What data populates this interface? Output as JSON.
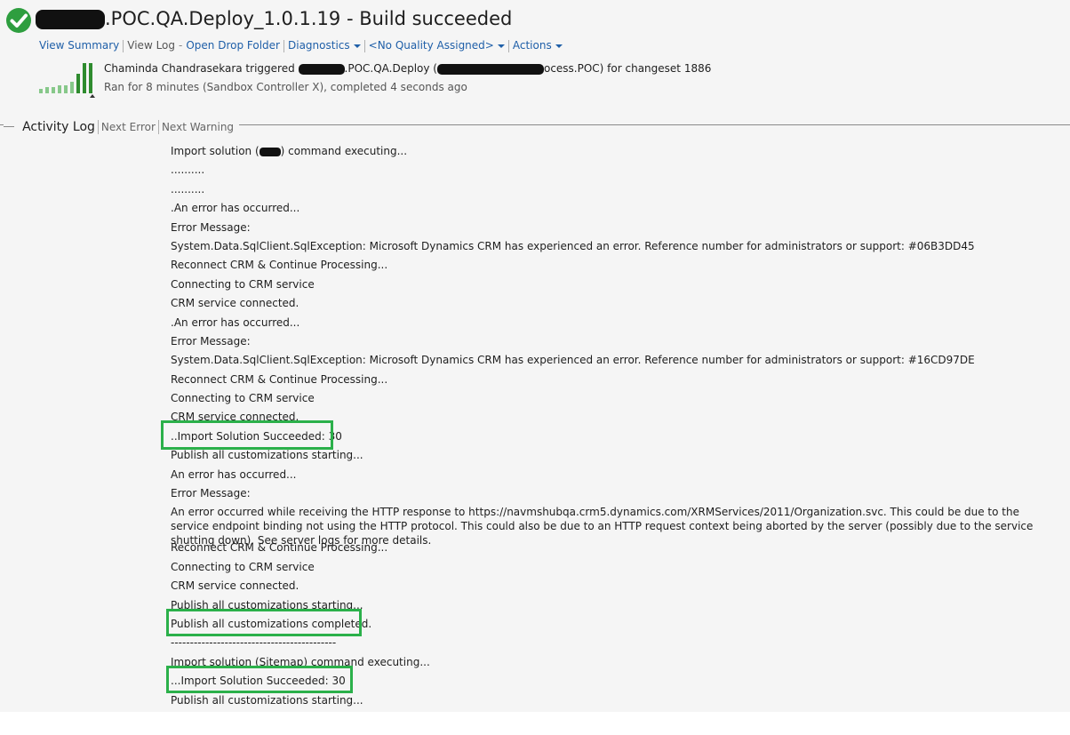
{
  "header": {
    "title": ".POC.QA.Deploy_1.0.1.19 - Build succeeded",
    "status_color": "#2e9e3f"
  },
  "nav": {
    "view_summary": "View Summary",
    "view_log": "View Log",
    "dash": "-",
    "open_drop_folder": "Open Drop Folder",
    "diagnostics": "Diagnostics",
    "quality": "<No Quality Assigned>",
    "actions": "Actions"
  },
  "build_info": {
    "trigger_user": "Chaminda Chandrasekara triggered",
    "trigger_def": ".POC.QA.Deploy (",
    "trigger_def_end": "ocess.POC) for changeset 1886",
    "ran_for": "Ran for 8 minutes (Sandbox Controller X), completed 4 seconds ago",
    "history_bar_levels": [
      0.15,
      0.2,
      0.2,
      0.25,
      0.25,
      0.35,
      0.6,
      0.95,
      0.95
    ],
    "accent_color": "#2e8b2e"
  },
  "tabs": {
    "activity_log": "Activity Log",
    "next_error": "Next Error",
    "next_warning": "Next Warning"
  },
  "log": {
    "import_start_a": "Import solution (",
    "import_start_b": ") command executing...",
    "lines_1": [
      "..........",
      "..........",
      ".An error has occurred...",
      "Error Message:",
      "System.Data.SqlClient.SqlException: Microsoft Dynamics CRM has experienced an error. Reference number for administrators or support: #06B3DD45",
      "Reconnect CRM & Continue Processing...",
      "Connecting to CRM service",
      "CRM service connected.",
      ".An error has occurred...",
      "Error Message:",
      "System.Data.SqlClient.SqlException: Microsoft Dynamics CRM has experienced an error. Reference number for administrators or support: #16CD97DE",
      "Reconnect CRM & Continue Processing...",
      "Connecting to CRM service",
      "CRM service connected.",
      "..Import Solution Succeeded: 30",
      "Publish all customizations starting...",
      "An error has occurred...",
      "Error Message:"
    ],
    "http_error": "An error occurred while receiving the HTTP response to https://navmshubqa.crm5.dynamics.com/XRMServices/2011/Organization.svc. This could be due to the service endpoint binding not using the HTTP protocol. This could also be due to an HTTP request context being aborted by the server (possibly due to the service shutting down). See server logs for more details.",
    "lines_2": [
      "Reconnect CRM & Continue Processing...",
      "Connecting to CRM service",
      "CRM service connected.",
      "Publish all customizations starting...",
      "Publish all customizations completed.",
      "-------------------------------------------",
      "Import solution (Sitemap) command executing...",
      "...Import Solution Succeeded: 30",
      "Publish all customizations starting..."
    ],
    "highlight_color": "#2bb04a"
  }
}
